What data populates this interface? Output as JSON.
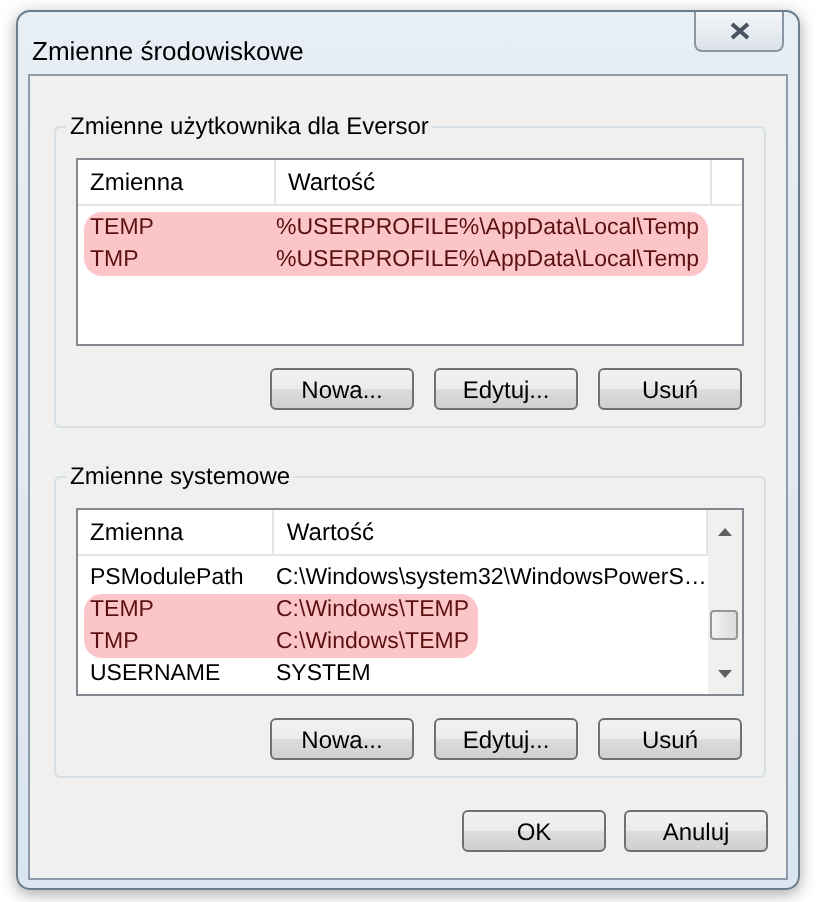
{
  "window": {
    "title": "Zmienne środowiskowe"
  },
  "groups": [
    {
      "title": "Zmienne użytkownika dla Eversor",
      "columns": [
        "Zmienna",
        "Wartość"
      ],
      "scrollbar": false,
      "rows": [
        {
          "name": "TEMP",
          "value": "%USERPROFILE%\\AppData\\Local\\Temp",
          "highlighted": true
        },
        {
          "name": "TMP",
          "value": "%USERPROFILE%\\AppData\\Local\\Temp",
          "highlighted": true
        }
      ],
      "buttons": [
        "Nowa...",
        "Edytuj...",
        "Usuń"
      ]
    },
    {
      "title": "Zmienne systemowe",
      "columns": [
        "Zmienna",
        "Wartość"
      ],
      "scrollbar": true,
      "rows": [
        {
          "name": "PSModulePath",
          "value": "C:\\Windows\\system32\\WindowsPowerS…",
          "highlighted": false
        },
        {
          "name": "TEMP",
          "value": "C:\\Windows\\TEMP",
          "highlighted": true
        },
        {
          "name": "TMP",
          "value": "C:\\Windows\\TEMP",
          "highlighted": true
        },
        {
          "name": "USERNAME",
          "value": "SYSTEM",
          "highlighted": false
        }
      ],
      "buttons": [
        "Nowa...",
        "Edytuj...",
        "Usuń"
      ]
    }
  ],
  "buttons": [
    "OK",
    "Anuluj"
  ]
}
